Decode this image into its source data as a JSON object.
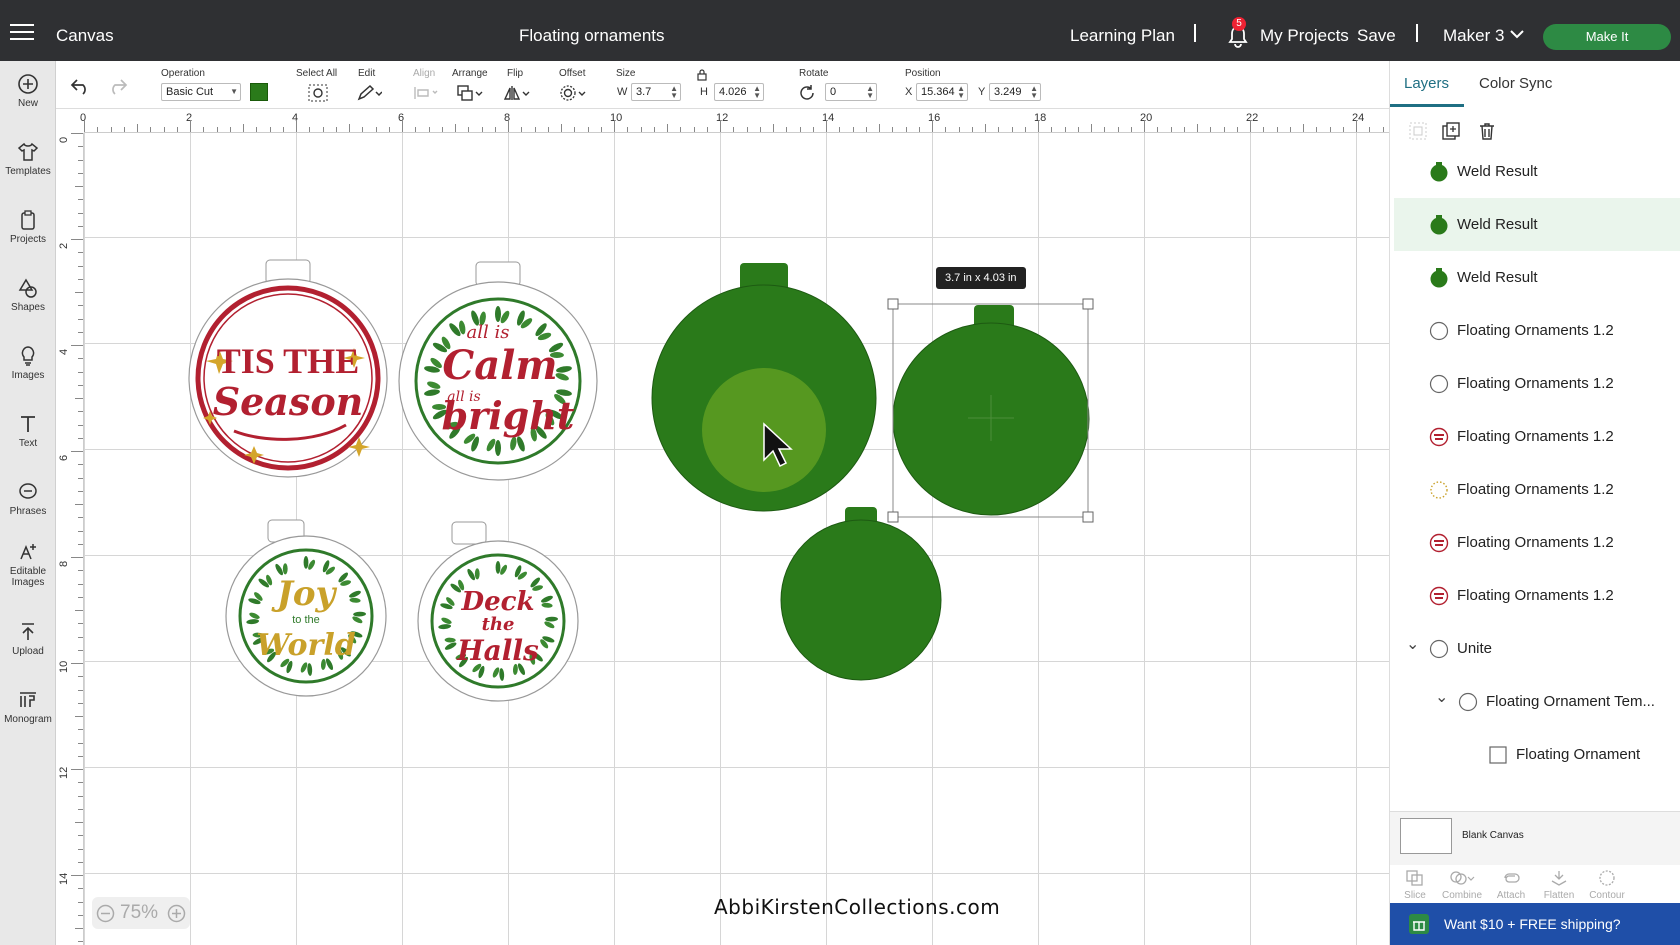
{
  "header": {
    "canvas_label": "Canvas",
    "project_title": "Floating ornaments",
    "learning_plan": "Learning Plan",
    "notification_count": "5",
    "my_projects": "My Projects",
    "save": "Save",
    "machine": "Maker 3",
    "make_it": "Make It"
  },
  "leftnav": {
    "items": [
      {
        "label": "New"
      },
      {
        "label": "Templates"
      },
      {
        "label": "Projects"
      },
      {
        "label": "Shapes"
      },
      {
        "label": "Images"
      },
      {
        "label": "Text"
      },
      {
        "label": "Phrases"
      },
      {
        "label": "Editable Images"
      },
      {
        "label": "Upload"
      },
      {
        "label": "Monogram"
      }
    ]
  },
  "toolbar": {
    "operation_label": "Operation",
    "operation_value": "Basic Cut",
    "operation_color": "#2a7a1a",
    "select_all": "Select All",
    "edit": "Edit",
    "align": "Align",
    "arrange": "Arrange",
    "flip": "Flip",
    "offset": "Offset",
    "size_label": "Size",
    "w_label": "W",
    "w_value": "3.7",
    "h_label": "H",
    "h_value": "4.026",
    "rotate_label": "Rotate",
    "rotate_value": "0",
    "position_label": "Position",
    "x_label": "X",
    "x_value": "15.364",
    "y_label": "Y",
    "y_value": "3.249"
  },
  "ruler": {
    "h_ticks": [
      "0",
      "2",
      "4",
      "6",
      "8",
      "10",
      "12",
      "14",
      "16",
      "18",
      "20",
      "22",
      "24"
    ],
    "v_ticks": [
      "0",
      "2",
      "4",
      "6",
      "8",
      "10",
      "12",
      "14"
    ]
  },
  "canvas": {
    "size_tooltip": "3.7  in x 4.03  in",
    "zoom": "75%",
    "watermark": "AbbiKirstenCollections.com",
    "ornament_color": "#2a7a1a",
    "ornaments": [
      {
        "lines": [
          "TIS THE",
          "Season"
        ]
      },
      {
        "lines": [
          "all is",
          "Calm",
          "all is",
          "bright"
        ]
      },
      {
        "lines": [
          "Joy",
          "to the",
          "World"
        ]
      },
      {
        "lines": [
          "Deck",
          "the",
          "Halls"
        ]
      }
    ]
  },
  "panel": {
    "tabs": [
      {
        "label": "Layers"
      },
      {
        "label": "Color Sync"
      }
    ],
    "layers": [
      {
        "label": "Weld Result",
        "icon": "filled-green-circle"
      },
      {
        "label": "Weld Result",
        "icon": "filled-green-circle"
      },
      {
        "label": "Weld Result",
        "icon": "filled-green-circle"
      },
      {
        "label": "Floating Ornaments 1.2",
        "icon": "outline-circle"
      },
      {
        "label": "Floating Ornaments 1.2",
        "icon": "outline-circle"
      },
      {
        "label": "Floating Ornaments 1.2",
        "icon": "red-design-thumb"
      },
      {
        "label": "Floating Ornaments 1.2",
        "icon": "dotted-circle"
      },
      {
        "label": "Floating Ornaments 1.2",
        "icon": "red-design-thumb"
      },
      {
        "label": "Floating Ornaments 1.2",
        "icon": "red-design-thumb"
      },
      {
        "label": "Unite",
        "icon": "outline-circle"
      },
      {
        "label": "Floating Ornament Tem...",
        "icon": "outline-circle"
      },
      {
        "label": "Floating Ornament",
        "icon": "square"
      }
    ],
    "blank_canvas": "Blank Canvas",
    "bottom_tools": [
      {
        "label": "Slice"
      },
      {
        "label": "Combine"
      },
      {
        "label": "Attach"
      },
      {
        "label": "Flatten"
      },
      {
        "label": "Contour"
      }
    ],
    "promo": "Want $10 + FREE shipping?"
  }
}
